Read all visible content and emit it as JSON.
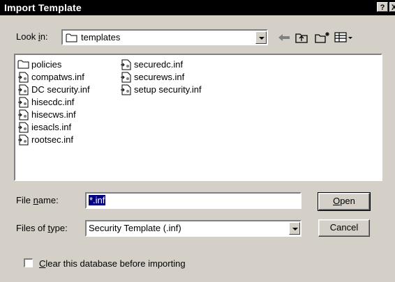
{
  "window": {
    "title": "Import Template",
    "help_glyph": "?",
    "close_glyph": "X"
  },
  "look_in": {
    "label_before": "Look ",
    "label_key": "i",
    "label_after": "n:",
    "value": "templates"
  },
  "toolbar": {
    "icons": [
      "back-arrow-icon",
      "up-folder-icon",
      "new-folder-icon",
      "view-menu-icon"
    ]
  },
  "files": {
    "column1": [
      "policies",
      "compatws.inf",
      "DC security.inf",
      "hisecdc.inf",
      "hisecws.inf",
      "iesacls.inf",
      "rootsec.inf"
    ],
    "column2": [
      "securedc.inf",
      "securews.inf",
      "setup security.inf"
    ]
  },
  "file_name": {
    "label_before": "File ",
    "label_key": "n",
    "label_after": "ame:",
    "value": "*.inf"
  },
  "files_of_type": {
    "label_before": "Files of ",
    "label_key": "t",
    "label_after": "ype:",
    "value": "Security Template (.inf)"
  },
  "buttons": {
    "open_key": "O",
    "open_rest": "pen",
    "cancel": "Cancel"
  },
  "clear_option": {
    "label_key": "C",
    "label_rest": "lear this database before importing",
    "checked": false
  },
  "colors": {
    "titlebar": "#000000",
    "dialog": "#d4d0c8",
    "selection": "#000080"
  }
}
